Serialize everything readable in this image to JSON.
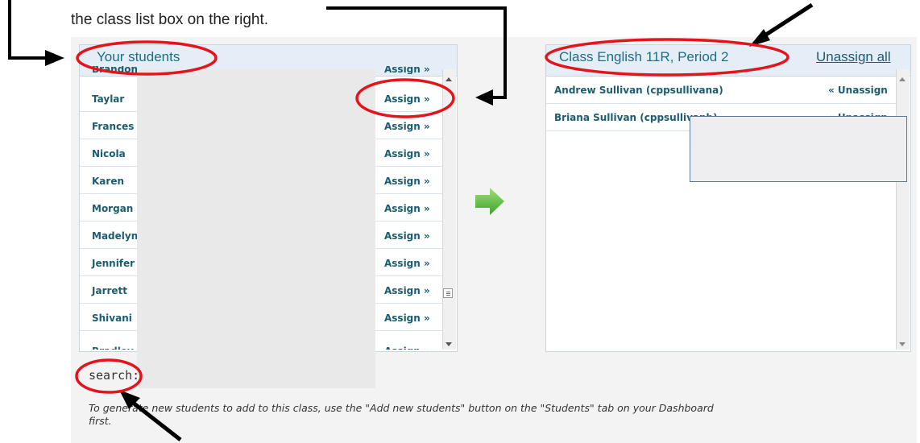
{
  "instruction": {
    "line": "the class list box on the right."
  },
  "students_panel": {
    "title": "Your students",
    "partial_top_name": "Brandon ...",
    "partial_top_assign": "Assign »",
    "rows": [
      {
        "name": "Taylar",
        "assign": "Assign »"
      },
      {
        "name": "Frances",
        "assign": "Assign »"
      },
      {
        "name": "Nicola",
        "assign": "Assign »"
      },
      {
        "name": "Karen",
        "assign": "Assign »"
      },
      {
        "name": "Morgan",
        "assign": "Assign »"
      },
      {
        "name": "Madelyn",
        "assign": "Assign »"
      },
      {
        "name": "Jennifer",
        "assign": "Assign »"
      },
      {
        "name": "Jarrett",
        "assign": "Assign »"
      },
      {
        "name": "Shivani",
        "assign": "Assign »"
      }
    ],
    "partial_bottom_name": "Bradley",
    "partial_bottom_assign": "Assign »"
  },
  "class_panel": {
    "title": "Class English 11R, Period 2",
    "unassign_all": "Unassign all",
    "rows": [
      {
        "name": "Andrew Sullivan (cppsullivana)",
        "unassign": "« Unassign"
      },
      {
        "name": "Briana Sullivan (cppsullivanb)",
        "unassign": "« Unassign"
      }
    ]
  },
  "search": {
    "label": "search:"
  },
  "footnote": {
    "line1": "To generate new students to add to this class, use the \"Add new students\" button on the \"Students\" tab on your Dashboard",
    "line2": "first."
  },
  "colors": {
    "accent": "#1b5d70",
    "annotation": "#e3141b",
    "arrow_green": "#5cb83a"
  },
  "icons": {
    "transfer": "green-arrow-right-icon",
    "scroll_up": "triangle-up-icon",
    "scroll_down": "triangle-down-icon"
  }
}
